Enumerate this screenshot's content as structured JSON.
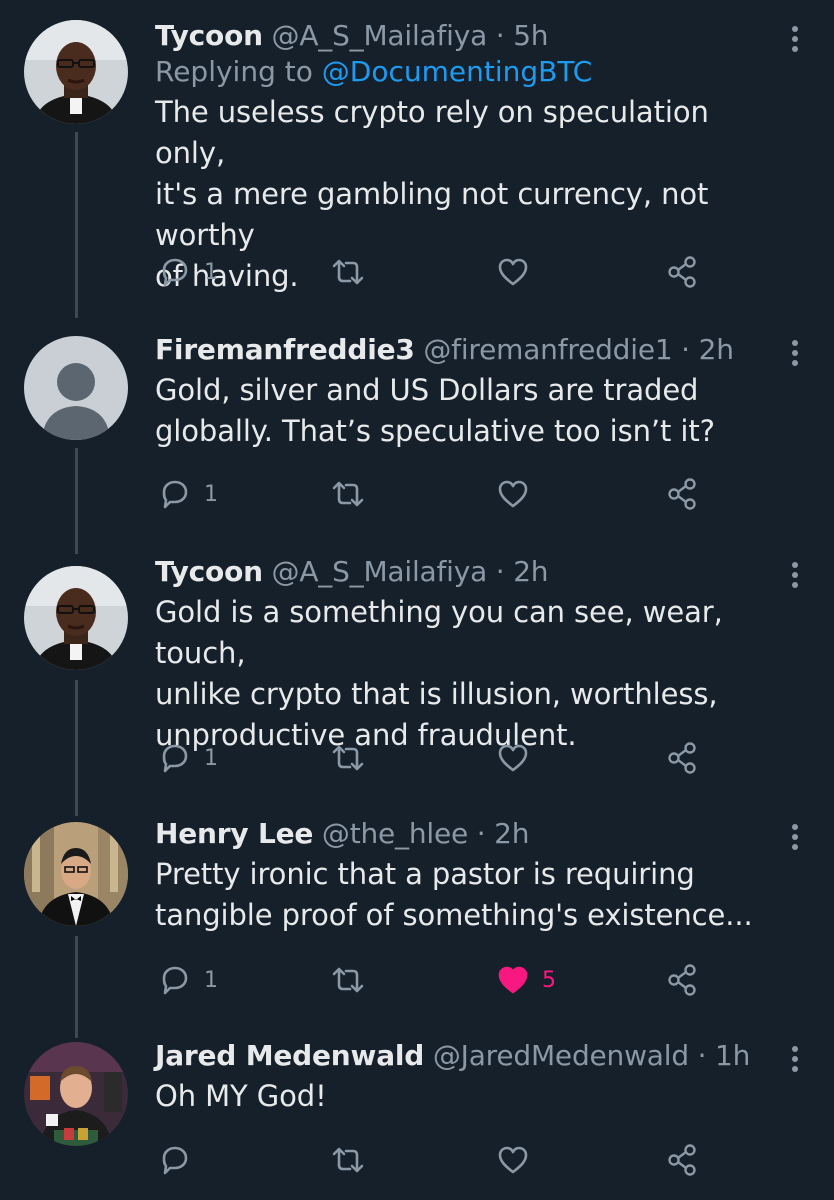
{
  "tweets": [
    {
      "name": "Tycoon",
      "handle": "@A_S_Mailafiya",
      "separator": "·",
      "time": "5h",
      "replying_prefix": "Replying to",
      "replying_to": "@DocumentingBTC",
      "text_lines": [
        "The useless crypto rely on speculation only,",
        "it's a mere gambling not currency, not worthy",
        "of having."
      ],
      "reply_count": "1",
      "retweet_count": "",
      "like_count": "",
      "liked": false,
      "avatar": "pastor-photo"
    },
    {
      "name": "Firemanfreddie3",
      "handle": "@firemanfreddie1",
      "separator": "·",
      "time": "2h",
      "text_lines": [
        "Gold, silver and US Dollars are traded",
        "globally. That’s speculative too isn’t it?"
      ],
      "reply_count": "1",
      "retweet_count": "",
      "like_count": "",
      "liked": false,
      "avatar": "default-avatar"
    },
    {
      "name": "Tycoon",
      "handle": "@A_S_Mailafiya",
      "separator": "·",
      "time": "2h",
      "text_lines": [
        "Gold is a something you can see, wear, touch,",
        "unlike crypto that is illusion, worthless,",
        "unproductive and fraudulent."
      ],
      "reply_count": "1",
      "retweet_count": "",
      "like_count": "",
      "liked": false,
      "avatar": "pastor-photo"
    },
    {
      "name": "Henry Lee",
      "handle": "@the_hlee",
      "separator": "·",
      "time": "2h",
      "text_lines": [
        "Pretty ironic that a pastor is requiring",
        "tangible proof of something's existence..."
      ],
      "reply_count": "1",
      "retweet_count": "",
      "like_count": "5",
      "liked": true,
      "avatar": "tuxedo-photo"
    },
    {
      "name": "Jared Medenwald",
      "handle": "@JaredMedenwald",
      "separator": "·",
      "time": "1h",
      "text_lines": [
        "Oh MY God!"
      ],
      "reply_count": "",
      "retweet_count": "",
      "like_count": "",
      "liked": false,
      "avatar": "studio-photo"
    }
  ],
  "colors": {
    "background": "#15202b",
    "primary_text": "#e7e9ea",
    "secondary_text": "#8b98a5",
    "link": "#1d9bf0",
    "like_active": "#f91880",
    "thread_line": "#3d4a56"
  },
  "icons": [
    "reply-icon",
    "retweet-icon",
    "like-icon",
    "share-icon",
    "more-icon"
  ]
}
